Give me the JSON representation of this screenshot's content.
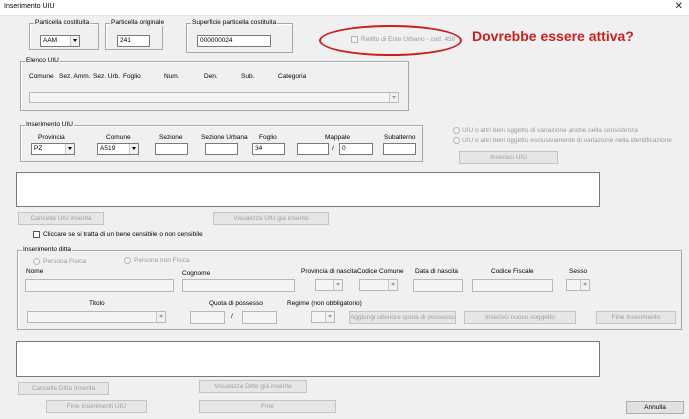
{
  "window": {
    "title": "Inserimento UIU",
    "close_glyph": "✕"
  },
  "top": {
    "particella_costituita": {
      "label": "Particella costituita",
      "value": "AAM"
    },
    "particella_originale": {
      "label": "Particella originale",
      "value": "241"
    },
    "superficie": {
      "label": "Superficie particella costituita",
      "value": "000000024"
    },
    "relitto_label": "Relitto di Ente Urbano - cod. 450"
  },
  "annotation": {
    "text": "Dovrebbe essere attiva?",
    "color": "#c81f1f"
  },
  "elenco": {
    "legend": "Elenco UIU",
    "columns": [
      "Comune",
      "Sez. Amm.",
      "Sez. Urb.",
      "Foglio",
      "Num.",
      "Den.",
      "Sub.",
      "Categoria"
    ]
  },
  "inserimento_uiu": {
    "legend": "Inserimento UIU",
    "provincia": {
      "label": "Provincia",
      "value": "PZ"
    },
    "comune": {
      "label": "Comune",
      "value": "A519"
    },
    "sezione": {
      "label": "Sezione",
      "value": ""
    },
    "sezione_urbana": {
      "label": "Sezione Urbana",
      "value": ""
    },
    "foglio": {
      "label": "Foglio",
      "value": "34"
    },
    "mappale": {
      "label": "Mappale",
      "value1": "",
      "sep": "/",
      "value2": "0"
    },
    "subalterno": {
      "label": "Subalterno",
      "value": ""
    }
  },
  "options": {
    "radio1": "UIU o altri beni oggetto di variazione anche nella consistenza",
    "radio2": "UIU o altri beni oggetto esclusivamente di variazione nella identificazione",
    "inserisci": "Inserisci UIU"
  },
  "buttons_uiu": {
    "cancella": "Cancella UIU inserita",
    "visualizza": "Visualizza UIU già inserite",
    "checkbox": "Cliccare se si tratta di un bene censibile o non censibile"
  },
  "ditta": {
    "legend": "Inserimento ditta",
    "persona_fisica": "Persona Fisica",
    "persona_non_fisica": "Persona non Fisica",
    "nome": "Nome",
    "cognome": "Cognome",
    "provincia_nascita": "Provincia di nascita",
    "codice_comune": "Codice Comune",
    "data_nascita": "Data di nascita",
    "codice_fiscale": "Codice Fiscale",
    "sesso": "Sesso",
    "titolo": "Titolo",
    "quota": "Quota di possesso",
    "quota_sep": "/",
    "regime": "Regime (non obbligatorio)",
    "aggiungi": "Aggiungi ulteriore quota di possesso",
    "inserisci_soggetto": "Inserisci nuovo soggetto",
    "fine_inserimento": "Fine Inserimento"
  },
  "bottom": {
    "cancella_ditta": "Cancella Ditta Inserita",
    "visualizza_ditte": "Visualizza Ditte già inserite",
    "fine_uiu": "Fine Inserimenti UIU",
    "fine": "Fine",
    "annulla": "Annulla"
  }
}
